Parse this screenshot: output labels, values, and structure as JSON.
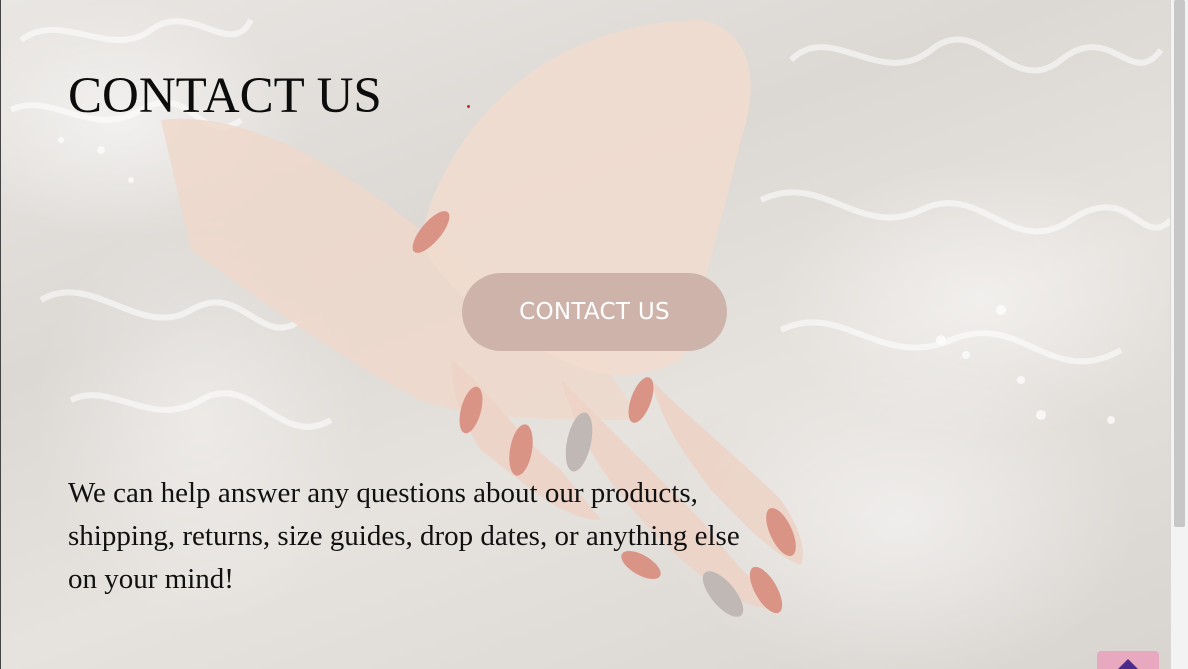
{
  "hero": {
    "title": "CONTACT US",
    "button_label": "CONTACT US",
    "body": "We can help answer any questions about our products, shipping, returns, size guides, drop dates, or anything else on your mind!"
  },
  "colors": {
    "button_background": "#ceb3ab",
    "button_text": "#ffffff",
    "title_text": "#0c0c0c",
    "back_to_top_background": "#e8a9c0",
    "back_to_top_icon": "#4a2a8a"
  },
  "icons": {
    "back_to_top": "chevron-up-icon"
  }
}
